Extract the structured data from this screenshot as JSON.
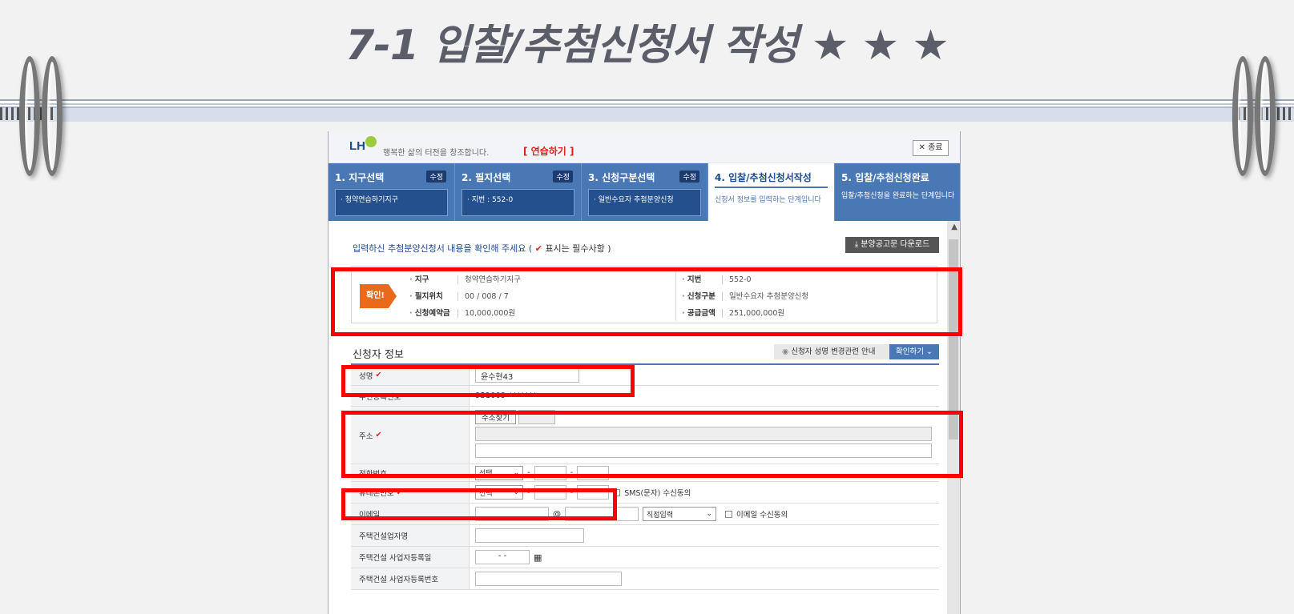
{
  "slide": {
    "title": "7-1 입찰/추첨신청서 작성 ★ ★ ★"
  },
  "header": {
    "logo": "LH",
    "slogan": "행복한 삶의 터전을 창조합니다.",
    "practice": "[ 연습하기 ]",
    "close": "✕ 종료"
  },
  "steps": [
    {
      "title": "1. 지구선택",
      "edit": "수정",
      "value": "· 청약연습하기지구"
    },
    {
      "title": "2. 필지선택",
      "edit": "수정",
      "value": "· 지번 : 552-0"
    },
    {
      "title": "3. 신청구분선택",
      "edit": "수정",
      "value": "· 일반수요자 추첨분양신청"
    },
    {
      "title": "4. 입찰/추첨신청서작성",
      "desc": "신청서 정보를 입력하는 단계입니다"
    },
    {
      "title": "5. 입찰/추첨신청완료",
      "desc": "입찰/추첨신청을 완료하는 단계입니다"
    }
  ],
  "notice": {
    "text": "입력하신 추첨분양신청서 내용을 확인해 주세요 (",
    "check": "✔",
    "req": "표시는 필수사항 )"
  },
  "download": "⤓  분양공고문 다운로드",
  "confirm": {
    "tag": "확인!",
    "left": [
      {
        "label": "지구",
        "value": "청약연습하기지구"
      },
      {
        "label": "필지위치",
        "value": "00 / 008 / 7"
      },
      {
        "label": "신청예약금",
        "value": "10,000,000원"
      }
    ],
    "right": [
      {
        "label": "지번",
        "value": "552-0"
      },
      {
        "label": "신청구분",
        "value": "일반수요자 추첨분양신청"
      },
      {
        "label": "공급금액",
        "value": "251,000,000원"
      }
    ]
  },
  "applicant": {
    "section_title": "신청자 정보",
    "guide": "신청자 성명 변경관련 안내",
    "confirm_btn": "확인하기 ⌄",
    "name_label": "성명",
    "name_value": "윤수현43",
    "rrn_label": "주민등록번호",
    "rrn_value": "931009-*******",
    "addr_label": "주소",
    "addr_btn": "주소찾기",
    "tel_label": "전화번호",
    "tel_select": "선택",
    "mobile_label": "휴대폰번호",
    "mobile_select": "선택",
    "sms": "SMS(문자) 수신동의",
    "email_label": "이메일",
    "email_at": "@",
    "email_select": "직접입력",
    "email_agree": "이메일 수신동의",
    "company_label": "주택건설업자명",
    "reg_date_label": "주택건설 사업자등록일",
    "reg_date_value": "- -",
    "reg_no_label": "주택건설 사업자등록번호",
    "dash": "-"
  }
}
